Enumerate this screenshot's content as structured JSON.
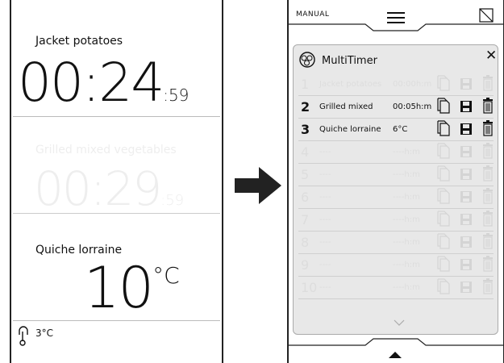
{
  "left_screen": {
    "timer1": {
      "label": "Jacket potatoes",
      "main": "00:24",
      "seconds": ":59"
    },
    "timer2": {
      "label": "Grilled mixed vegetables",
      "main": "00:29",
      "seconds": ":59"
    },
    "timer3": {
      "label": "Quiche lorraine",
      "main": "10",
      "unit": "°C"
    },
    "probe": {
      "value": "3°C"
    }
  },
  "right_screen": {
    "mode": "MANUAL",
    "title": "MultiTimer",
    "rows": [
      {
        "num": "1",
        "name": "Jacket potatoes",
        "time": "00:00h:m",
        "active": false
      },
      {
        "num": "2",
        "name": "Grilled mixed",
        "time": "00:05h:m",
        "active": true
      },
      {
        "num": "3",
        "name": "Quiche lorraine",
        "time": "6°C",
        "active": true
      },
      {
        "num": "4",
        "name": "----",
        "time": "----h:m",
        "active": false
      },
      {
        "num": "5",
        "name": "----",
        "time": "----h:m",
        "active": false
      },
      {
        "num": "6",
        "name": "----",
        "time": "----h:m",
        "active": false
      },
      {
        "num": "7",
        "name": "----",
        "time": "----h:m",
        "active": false
      },
      {
        "num": "8",
        "name": "----",
        "time": "----h:m",
        "active": false
      },
      {
        "num": "9",
        "name": "----",
        "time": "----h:m",
        "active": false
      },
      {
        "num": "10",
        "name": "----",
        "time": "----h:m",
        "active": false
      }
    ]
  },
  "icons": {
    "arrow": "right-arrow-icon",
    "menu": "hamburger-icon",
    "close": "close-icon",
    "timer": "multitimer-icon",
    "copy": "copy-icon",
    "save": "save-icon",
    "delete": "trash-icon",
    "probe": "probe-icon"
  }
}
